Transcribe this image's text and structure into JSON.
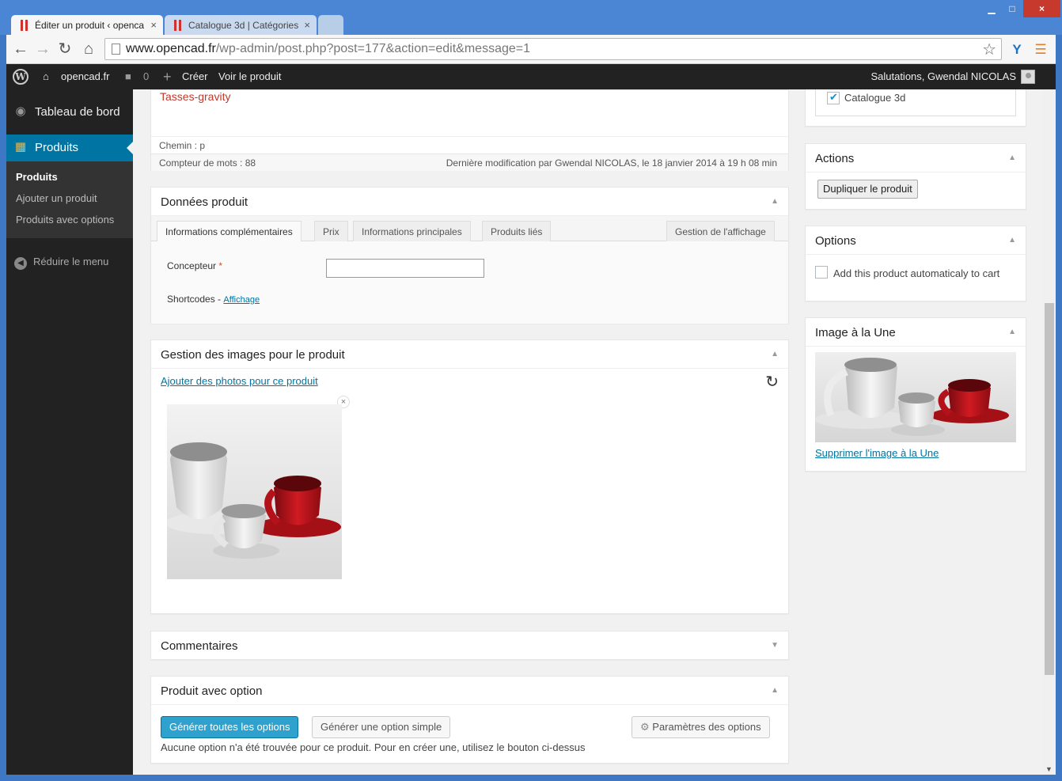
{
  "browser": {
    "tabs": [
      {
        "title": "Éditer un produit ‹ openca"
      },
      {
        "title": "Catalogue 3d | Catégories"
      }
    ],
    "url_host": "www.opencad.fr",
    "url_path": "/wp-admin/post.php?post=177&action=edit&message=1",
    "close_glyph": "×",
    "minimize_glyph": "▁",
    "maximize_glyph": "□"
  },
  "adminbar": {
    "site_name": "opencad.fr",
    "comments_count": "0",
    "new_label": "Créer",
    "view_label": "Voir le produit",
    "greeting": "Salutations, Gwendal NICOLAS"
  },
  "menu": {
    "dashboard": "Tableau de bord",
    "products": "Produits",
    "sub": [
      "Produits",
      "Ajouter un produit",
      "Produits avec options"
    ],
    "collapse": "Réduire le menu"
  },
  "editor": {
    "content_excerpt": "Tasses-gravity",
    "path": "Chemin : p",
    "word_count": "Compteur de mots : 88",
    "last_modified": "Dernière modification par Gwendal NICOLAS, le 18 janvier 2014 à 19 h 08 min"
  },
  "product_data": {
    "title": "Données produit",
    "tabs": [
      "Informations complémentaires",
      "Prix",
      "Informations principales",
      "Produits liés",
      "Gestion de l'affichage"
    ],
    "designer_label": "Concepteur",
    "required_mark": "*",
    "designer_value": "",
    "shortcodes_label": "Shortcodes -",
    "shortcodes_link": "Affichage"
  },
  "images_box": {
    "title": "Gestion des images pour le produit",
    "add_link": "Ajouter des photos pour ce produit",
    "remove_glyph": "×"
  },
  "comments_box": {
    "title": "Commentaires"
  },
  "options_product_box": {
    "title": "Produit avec option",
    "btn_generate_all": "Générer toutes les options",
    "btn_generate_simple": "Générer une option simple",
    "btn_settings": "Paramètres des options",
    "empty_notice": "Aucune option n'a été trouvée pour ce produit. Pour en créer une, utilisez le bouton ci-dessus"
  },
  "sidebar": {
    "category_label": "Catalogue 3d",
    "category_checked": true,
    "actions_title": "Actions",
    "duplicate_btn": "Dupliquer le produit",
    "options_title": "Options",
    "add_to_cart_label": "Add this product automaticaly to cart",
    "add_to_cart_checked": false,
    "featured_title": "Image à la Une",
    "remove_featured": "Supprimer l'image à la Une"
  },
  "colors": {
    "wp_blue": "#0074a2",
    "primary_button": "#2ea2cc",
    "admin_dark": "#222222",
    "chrome_blue": "#4a86d4",
    "mug_red": "#b3121a"
  }
}
